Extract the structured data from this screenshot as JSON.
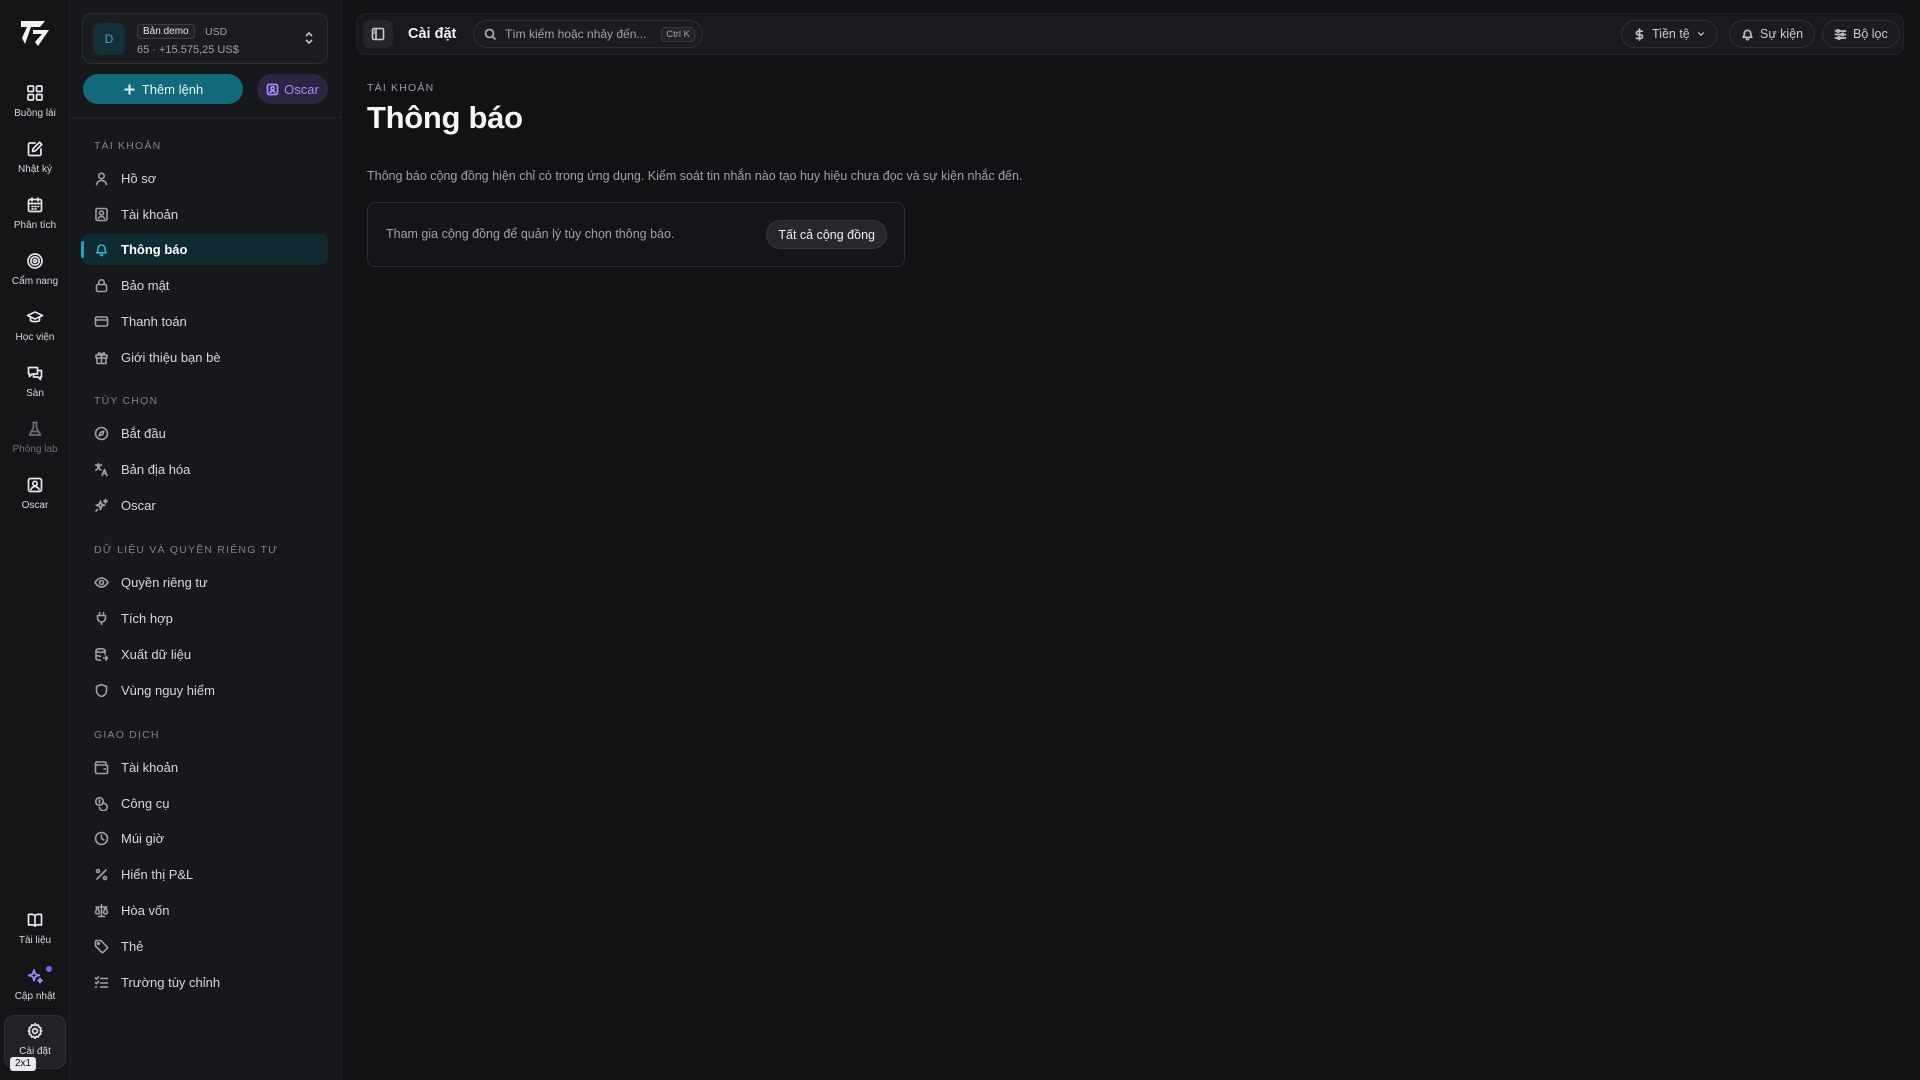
{
  "rail": {
    "items": [
      {
        "label": "Buồng lái",
        "icon": "dashboard-icon"
      },
      {
        "label": "Nhật ký",
        "icon": "journal-icon"
      },
      {
        "label": "Phân tích",
        "icon": "calendar-icon"
      },
      {
        "label": "Cẩm nang",
        "icon": "target-icon"
      },
      {
        "label": "Học viện",
        "icon": "graduation-cap-icon"
      },
      {
        "label": "Sàn",
        "icon": "chat-icon"
      },
      {
        "label": "Phòng lab",
        "icon": "flask-icon"
      },
      {
        "label": "Oscar",
        "icon": "oscar-icon"
      }
    ],
    "bottom": [
      {
        "label": "Tài liệu",
        "icon": "book-icon"
      },
      {
        "label": "Cập nhật",
        "icon": "sparkle-icon"
      },
      {
        "label": "Cài đặt",
        "icon": "gear-icon"
      }
    ],
    "zoom_badge": "2x1"
  },
  "account": {
    "avatar": "D",
    "badge": "Bản demo",
    "currency": "USD",
    "summary": "65 · +15.575,25 US$"
  },
  "actions": {
    "add_label": "Thêm lệnh",
    "oscar_label": "Oscar"
  },
  "sidebar": {
    "sections": [
      {
        "title": "Tài khoản",
        "items": [
          "Hồ sơ",
          "Tài khoản",
          "Thông báo",
          "Bảo mật",
          "Thanh toán",
          "Giới thiệu bạn bè"
        ]
      },
      {
        "title": "Tùy chọn",
        "items": [
          "Bắt đầu",
          "Bản địa hóa",
          "Oscar"
        ]
      },
      {
        "title": "Dữ liệu và quyền riêng tư",
        "items": [
          "Quyền riêng tư",
          "Tích hợp",
          "Xuất dữ liệu",
          "Vùng nguy hiểm"
        ]
      },
      {
        "title": "Giao dịch",
        "items": [
          "Tài khoản",
          "Công cụ",
          "Múi giờ",
          "Hiển thị P&L",
          "Hòa vốn",
          "Thẻ",
          "Trường tùy chỉnh"
        ]
      }
    ],
    "active_item": "Thông báo"
  },
  "topbar": {
    "title": "Cài đặt",
    "search_placeholder": "Tìm kiếm hoặc nhảy đến...",
    "search_shortcut": "Ctrl K",
    "currency_label": "Tiền tệ",
    "events_label": "Sự kiện",
    "filter_label": "Bộ lọc"
  },
  "main": {
    "breadcrumb": "Tài khoản",
    "title": "Thông báo",
    "description": "Thông báo cộng đồng hiện chỉ có trong ứng dụng. Kiểm soát tin nhắn nào tạo huy hiệu chưa đọc và sự kiện nhắc đến.",
    "card_text": "Tham gia cộng đồng để quản lý tùy chọn thông báo.",
    "card_button": "Tất cả cộng đồng"
  },
  "colors": {
    "accent": "#136a7a",
    "active_nav_bg": "#102a32",
    "oscar_purple": "#a78bfa",
    "background": "#111214"
  }
}
